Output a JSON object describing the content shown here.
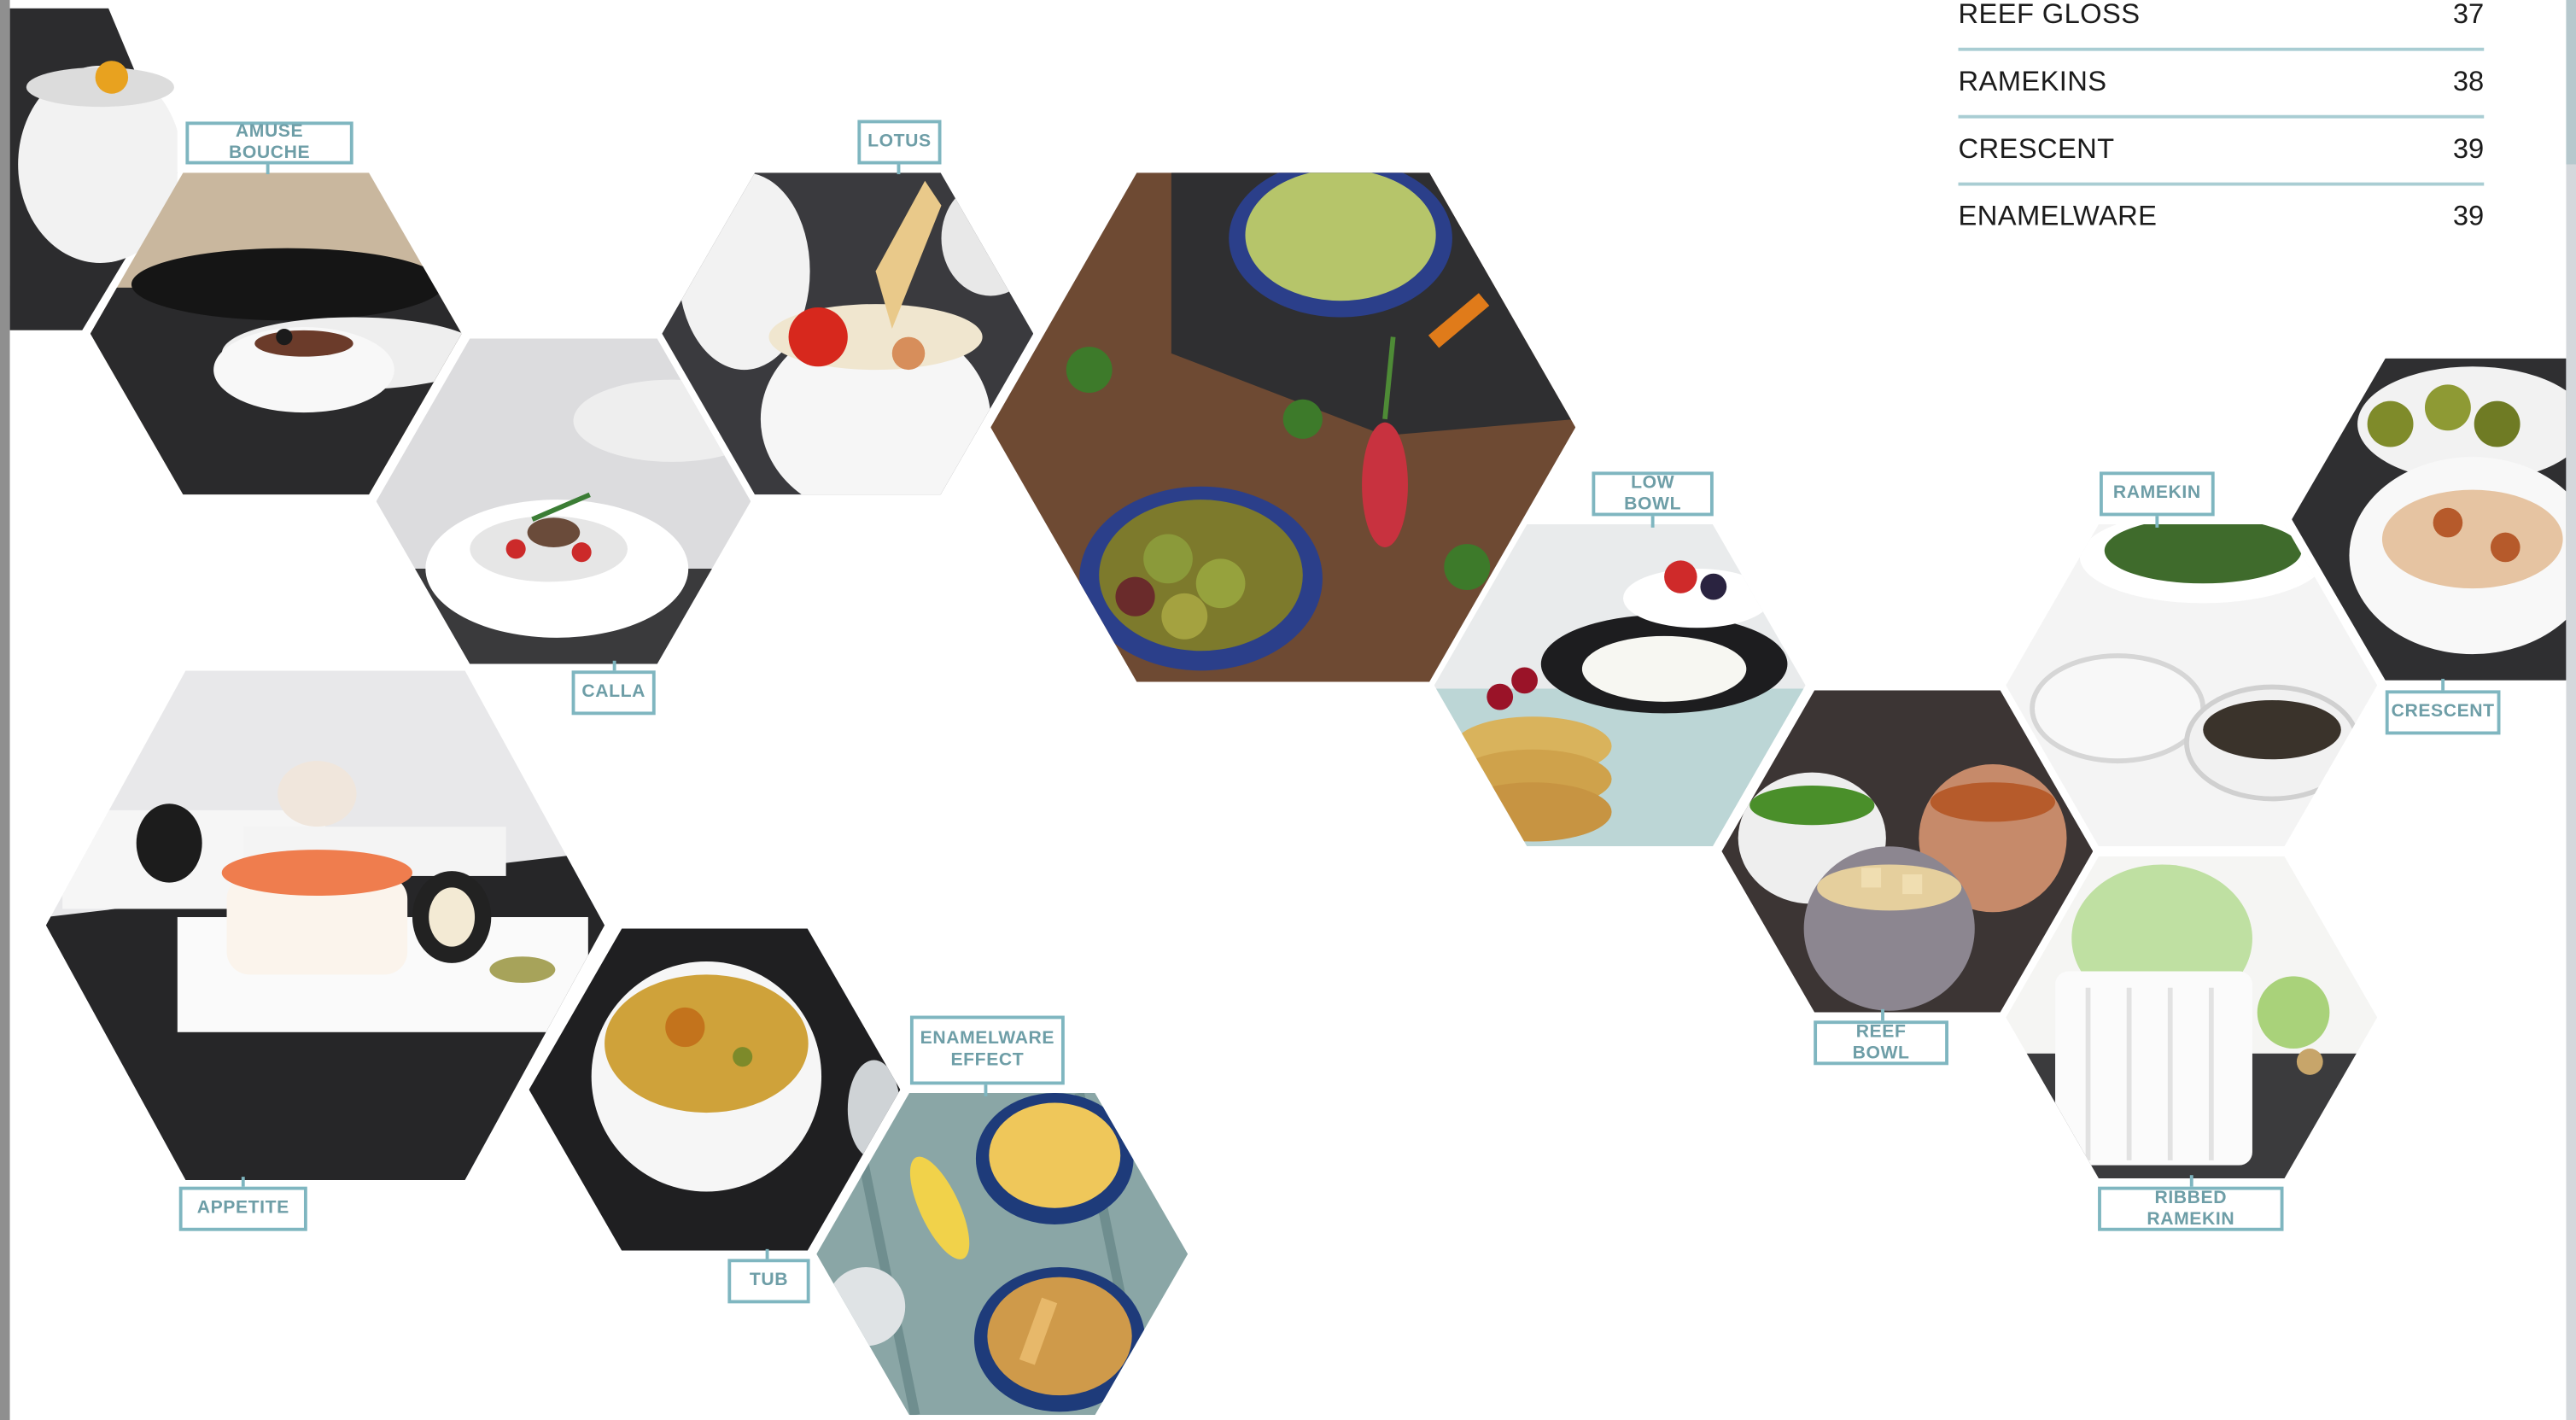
{
  "index": [
    {
      "name": "REEF GLOSS",
      "page": "37"
    },
    {
      "name": "RAMEKINS",
      "page": "38"
    },
    {
      "name": "CRESCENT",
      "page": "39"
    },
    {
      "name": "ENAMELWARE",
      "page": "39"
    }
  ],
  "labels": {
    "amuse_bouche": "AMUSE BOUCHE",
    "lotus": "LOTUS",
    "calla": "CALLA",
    "low_bowl": "LOW BOWL",
    "ramekin": "RAMEKIN",
    "crescent": "CRESCENT",
    "appetite": "APPETITE",
    "tub": "TUB",
    "enamelware_effect_line1": "ENAMELWARE",
    "enamelware_effect_line2": "EFFECT",
    "reef_bowl": "REEF BOWL",
    "ribbed_ramekin": "RIBBED RAMEKIN"
  },
  "photos": [
    "amuse-bouche-photo",
    "calla-photo",
    "lotus-photo",
    "snack-platter-photo",
    "low-bowl-photo",
    "reef-bowl-photo",
    "ramekin-photo",
    "crescent-photo",
    "ribbed-ramekin-photo",
    "appetite-photo",
    "tub-photo",
    "enamelware-photo"
  ],
  "colors": {
    "label_border": "#7fb6c0",
    "label_text": "#6e9ea7",
    "rule": "#a9cdd3",
    "text": "#1b1b1b"
  }
}
